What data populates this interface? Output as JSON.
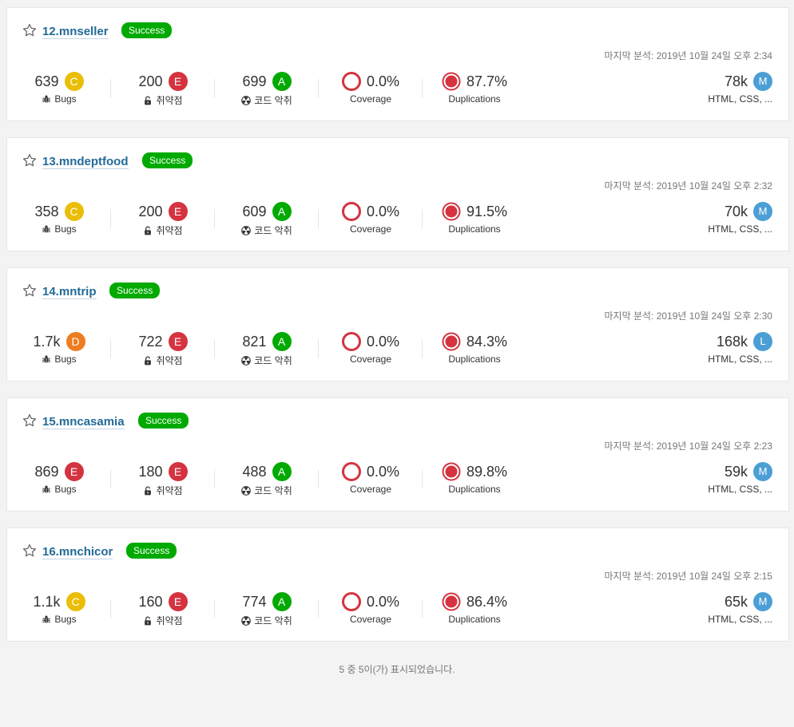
{
  "projects": [
    {
      "name": "12.mnseller",
      "status": "Success",
      "last_analysis": "마지막 분석: 2019년 10월 24일 오후 2:34",
      "bugs": {
        "value": "639",
        "rating": "C",
        "label": "Bugs"
      },
      "vulnerabilities": {
        "value": "200",
        "rating": "E",
        "label": "취약점"
      },
      "code_smells": {
        "value": "699",
        "rating": "A",
        "label": "코드 악취"
      },
      "coverage": {
        "value": "0.0%",
        "label": "Coverage"
      },
      "duplications": {
        "value": "87.7%",
        "label": "Duplications"
      },
      "size": {
        "value": "78k",
        "rating": "M",
        "label": "HTML, CSS, ..."
      }
    },
    {
      "name": "13.mndeptfood",
      "status": "Success",
      "last_analysis": "마지막 분석: 2019년 10월 24일 오후 2:32",
      "bugs": {
        "value": "358",
        "rating": "C",
        "label": "Bugs"
      },
      "vulnerabilities": {
        "value": "200",
        "rating": "E",
        "label": "취약점"
      },
      "code_smells": {
        "value": "609",
        "rating": "A",
        "label": "코드 악취"
      },
      "coverage": {
        "value": "0.0%",
        "label": "Coverage"
      },
      "duplications": {
        "value": "91.5%",
        "label": "Duplications"
      },
      "size": {
        "value": "70k",
        "rating": "M",
        "label": "HTML, CSS, ..."
      }
    },
    {
      "name": "14.mntrip",
      "status": "Success",
      "last_analysis": "마지막 분석: 2019년 10월 24일 오후 2:30",
      "bugs": {
        "value": "1.7k",
        "rating": "D",
        "label": "Bugs"
      },
      "vulnerabilities": {
        "value": "722",
        "rating": "E",
        "label": "취약점"
      },
      "code_smells": {
        "value": "821",
        "rating": "A",
        "label": "코드 악취"
      },
      "coverage": {
        "value": "0.0%",
        "label": "Coverage"
      },
      "duplications": {
        "value": "84.3%",
        "label": "Duplications"
      },
      "size": {
        "value": "168k",
        "rating": "L",
        "label": "HTML, CSS, ..."
      }
    },
    {
      "name": "15.mncasamia",
      "status": "Success",
      "last_analysis": "마지막 분석: 2019년 10월 24일 오후 2:23",
      "bugs": {
        "value": "869",
        "rating": "E",
        "label": "Bugs"
      },
      "vulnerabilities": {
        "value": "180",
        "rating": "E",
        "label": "취약점"
      },
      "code_smells": {
        "value": "488",
        "rating": "A",
        "label": "코드 악취"
      },
      "coverage": {
        "value": "0.0%",
        "label": "Coverage"
      },
      "duplications": {
        "value": "89.8%",
        "label": "Duplications"
      },
      "size": {
        "value": "59k",
        "rating": "M",
        "label": "HTML, CSS, ..."
      }
    },
    {
      "name": "16.mnchicor",
      "status": "Success",
      "last_analysis": "마지막 분석: 2019년 10월 24일 오후 2:15",
      "bugs": {
        "value": "1.1k",
        "rating": "C",
        "label": "Bugs"
      },
      "vulnerabilities": {
        "value": "160",
        "rating": "E",
        "label": "취약점"
      },
      "code_smells": {
        "value": "774",
        "rating": "A",
        "label": "코드 악취"
      },
      "coverage": {
        "value": "0.0%",
        "label": "Coverage"
      },
      "duplications": {
        "value": "86.4%",
        "label": "Duplications"
      },
      "size": {
        "value": "65k",
        "rating": "M",
        "label": "HTML, CSS, ..."
      }
    }
  ],
  "footer": {
    "text": "5 중 5이(가) 표시되었습니다."
  },
  "icons": {
    "favorite": "star-outline-icon",
    "bugs": "bug-icon",
    "vulnerabilities": "unlocked-padlock-icon",
    "code_smells": "radiation-icon",
    "coverage": "coverage-ring-icon",
    "duplications": "duplications-ring-icon"
  },
  "colors": {
    "rating_A": "#00aa00",
    "rating_C": "#eabe06",
    "rating_D": "#ed7d20",
    "rating_E": "#d4333f",
    "size_badge": "#4b9fd5",
    "status_success": "#00aa00",
    "link": "#236a97",
    "ring_red": "#d4333f"
  }
}
